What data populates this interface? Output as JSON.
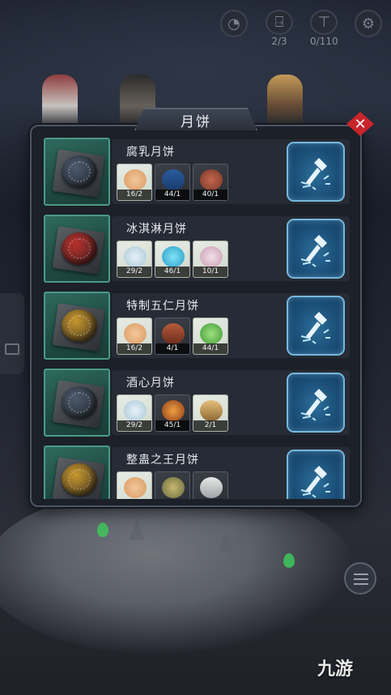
{
  "hud": {
    "timer_icon": "timer-icon",
    "door_count": "2/3",
    "box_count": "0/110",
    "settings_icon": "gear-icon"
  },
  "modal": {
    "title": "月饼",
    "close_icon": "close-icon"
  },
  "recipes": [
    {
      "name": "腐乳月饼",
      "cake_color": "#4a5a6e",
      "materials": [
        {
          "icon": "flour-icon",
          "qty": "16/2"
        },
        {
          "icon": "water-tank-icon",
          "qty": "44/1"
        },
        {
          "icon": "meat-icon",
          "qty": "40/1"
        }
      ]
    },
    {
      "name": "冰淇淋月饼",
      "cake_color": "#b8302c",
      "materials": [
        {
          "icon": "sugar-icon",
          "qty": "29/2"
        },
        {
          "icon": "ice-crystal-icon",
          "qty": "46/1"
        },
        {
          "icon": "cream-icon",
          "qty": "10/1"
        }
      ]
    },
    {
      "name": "特制五仁月饼",
      "cake_color": "#c9972e",
      "materials": [
        {
          "icon": "flour-icon",
          "qty": "16/2"
        },
        {
          "icon": "nut-cake-icon",
          "qty": "4/1"
        },
        {
          "icon": "herb-icon",
          "qty": "44/1"
        }
      ]
    },
    {
      "name": "酒心月饼",
      "cake_color": "#4a5a6e",
      "materials": [
        {
          "icon": "sugar-icon",
          "qty": "29/2"
        },
        {
          "icon": "liquor-jar-icon",
          "qty": "45/1"
        },
        {
          "icon": "bottle-icon",
          "qty": "2/1"
        }
      ]
    },
    {
      "name": "整蛊之王月饼",
      "cake_color": "#c9972e",
      "materials": [
        {
          "icon": "flour-icon",
          "qty": ""
        },
        {
          "icon": "pot-icon",
          "qty": ""
        },
        {
          "icon": "feather-icon",
          "qty": ""
        }
      ]
    }
  ],
  "craft_icon": "hammer-icon",
  "watermark": "九游"
}
